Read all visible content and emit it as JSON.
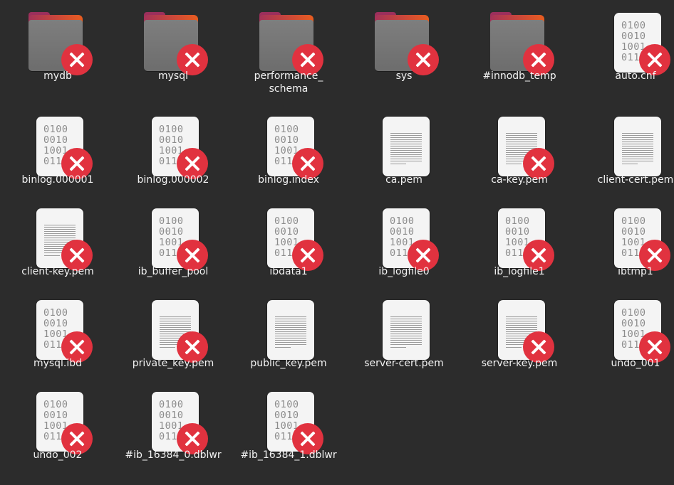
{
  "badge_color": "#e1323f",
  "folder_colors": {
    "accent": "#cf4a36",
    "body": "#787878"
  },
  "files": [
    {
      "name": "mydb",
      "type": "folder",
      "emblem": "unreadable-emblem-icon"
    },
    {
      "name": "mysql",
      "type": "folder",
      "emblem": "unreadable-emblem-icon"
    },
    {
      "name": "performance_\nschema",
      "type": "folder",
      "emblem": "unreadable-emblem-icon"
    },
    {
      "name": "sys",
      "type": "folder",
      "emblem": "unreadable-emblem-icon"
    },
    {
      "name": "#innodb_temp",
      "type": "folder",
      "emblem": "unreadable-emblem-icon"
    },
    {
      "name": "auto.cnf",
      "type": "binary",
      "emblem": "unreadable-emblem-icon"
    },
    {
      "name": "binlog.000001",
      "type": "binary",
      "emblem": "unreadable-emblem-icon"
    },
    {
      "name": "binlog.000002",
      "type": "binary",
      "emblem": "unreadable-emblem-icon"
    },
    {
      "name": "binlog.index",
      "type": "binary",
      "emblem": "unreadable-emblem-icon"
    },
    {
      "name": "ca.pem",
      "type": "text",
      "emblem": ""
    },
    {
      "name": "ca-key.pem",
      "type": "text",
      "emblem": "unreadable-emblem-icon"
    },
    {
      "name": "client-cert.pem",
      "type": "text",
      "emblem": ""
    },
    {
      "name": "client-key.pem",
      "type": "text",
      "emblem": "unreadable-emblem-icon"
    },
    {
      "name": "ib_buffer_pool",
      "type": "binary",
      "emblem": "unreadable-emblem-icon"
    },
    {
      "name": "ibdata1",
      "type": "binary",
      "emblem": "unreadable-emblem-icon"
    },
    {
      "name": "ib_logfile0",
      "type": "binary",
      "emblem": "unreadable-emblem-icon"
    },
    {
      "name": "ib_logfile1",
      "type": "binary",
      "emblem": "unreadable-emblem-icon"
    },
    {
      "name": "ibtmp1",
      "type": "binary",
      "emblem": "unreadable-emblem-icon"
    },
    {
      "name": "mysql.ibd",
      "type": "binary",
      "emblem": "unreadable-emblem-icon"
    },
    {
      "name": "private_key.pem",
      "type": "text",
      "emblem": "unreadable-emblem-icon"
    },
    {
      "name": "public_key.pem",
      "type": "text",
      "emblem": ""
    },
    {
      "name": "server-cert.pem",
      "type": "text",
      "emblem": ""
    },
    {
      "name": "server-key.pem",
      "type": "text",
      "emblem": "unreadable-emblem-icon"
    },
    {
      "name": "undo_001",
      "type": "binary",
      "emblem": "unreadable-emblem-icon"
    },
    {
      "name": "undo_002",
      "type": "binary",
      "emblem": "unreadable-emblem-icon"
    },
    {
      "name": "#ib_16384_0.dblwr",
      "type": "binary",
      "emblem": "unreadable-emblem-icon"
    },
    {
      "name": "#ib_16384_1.dblwr",
      "type": "binary",
      "emblem": "unreadable-emblem-icon"
    }
  ]
}
